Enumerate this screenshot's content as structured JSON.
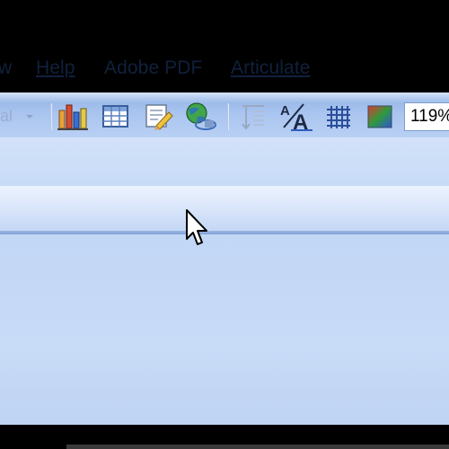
{
  "menubar": {
    "items": [
      {
        "label": "w"
      },
      {
        "label": "Help"
      },
      {
        "label": "Adobe PDF"
      },
      {
        "label": "Articulate"
      }
    ]
  },
  "toolbar": {
    "left_partial_label": "al",
    "buttons": [
      {
        "icon": "chart-icon"
      },
      {
        "icon": "table-icon"
      },
      {
        "icon": "document-edit-icon"
      },
      {
        "icon": "globe-icon"
      },
      {
        "icon": "text-direction-icon"
      },
      {
        "icon": "font-scale-icon"
      },
      {
        "icon": "grid-icon"
      },
      {
        "icon": "color-gradient-icon"
      }
    ],
    "zoom_value": "119%"
  },
  "colors": {
    "window_bg": "#c8dbf7",
    "menubar_text": "#10213d",
    "toolbar_border": "#8aa9da"
  }
}
